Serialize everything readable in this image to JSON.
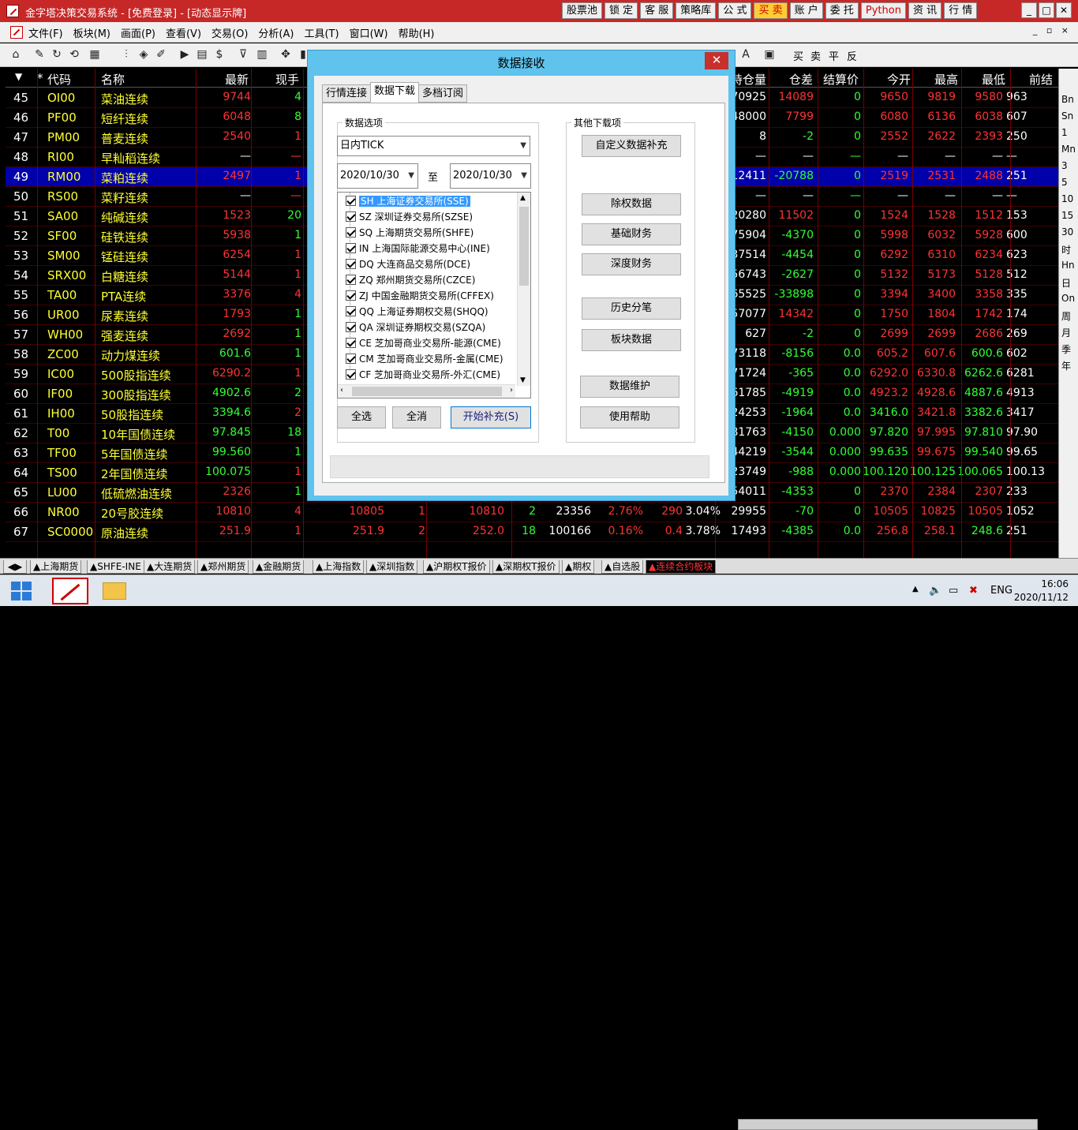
{
  "window": {
    "title": "金字塔决策交易系统 - [免费登录] - [动态显示牌]",
    "top_buttons": [
      "股票池",
      "锁 定",
      "客 服",
      "策略库",
      "公 式",
      "买 卖",
      "账 户",
      "委 托",
      "Python",
      "资 讯",
      "行 情"
    ],
    "controls": [
      "_",
      "□",
      "✕"
    ]
  },
  "menu": {
    "items": [
      "文件(F)",
      "板块(M)",
      "画面(P)",
      "查看(V)",
      "交易(O)",
      "分析(A)",
      "工具(T)",
      "窗口(W)",
      "帮助(H)"
    ],
    "right": "_ ▫ ×"
  },
  "toolbar": {
    "right_items": [
      "买",
      "卖",
      "平",
      "反"
    ]
  },
  "table": {
    "headers": [
      "▼",
      "*",
      "代码",
      "名称",
      "最新",
      "现手",
      "持仓量",
      "仓差",
      "结算价",
      "今开",
      "最高",
      "最低",
      "前结"
    ],
    "rows": [
      {
        "n": "45",
        "code": "OI00",
        "name": "菜油连续",
        "last": "9744",
        "vol": "4",
        "a": "",
        "b": "",
        "c": "",
        "d": "",
        "e": "",
        "f": "",
        "oi": "70925",
        "chg": "14089",
        "settle": "0",
        "open": "9650",
        "high": "9819",
        "low": "9580",
        "prev": "963"
      },
      {
        "n": "46",
        "code": "PF00",
        "name": "短纤连续",
        "last": "6048",
        "vol": "8",
        "a": "",
        "b": "",
        "c": "",
        "d": "",
        "e": "",
        "f": "",
        "oi": "48000",
        "chg": "7799",
        "settle": "0",
        "open": "6080",
        "high": "6136",
        "low": "6038",
        "prev": "607"
      },
      {
        "n": "47",
        "code": "PM00",
        "name": "普麦连续",
        "last": "2540",
        "vol": "1",
        "a": "",
        "b": "",
        "c": "",
        "d": "",
        "e": "",
        "f": "",
        "oi": "8",
        "chg": "-2",
        "settle": "0",
        "open": "2552",
        "high": "2622",
        "low": "2393",
        "prev": "250"
      },
      {
        "n": "48",
        "code": "RI00",
        "name": "早籼稻连续",
        "last": "—",
        "vol": "—",
        "a": "",
        "b": "",
        "c": "",
        "d": "",
        "e": "",
        "f": "",
        "oi": "—",
        "chg": "—",
        "settle": "—",
        "open": "—",
        "high": "—",
        "low": "—",
        "prev": "—"
      },
      {
        "n": "49",
        "code": "RM00",
        "name": "菜粕连续",
        "last": "2497",
        "vol": "1",
        "a": "",
        "b": "",
        "c": "",
        "d": "",
        "e": "",
        "f": "",
        "oi": "12411",
        "chg": "-20788",
        "settle": "0",
        "open": "2519",
        "high": "2531",
        "low": "2488",
        "prev": "251"
      },
      {
        "n": "50",
        "code": "RS00",
        "name": "菜籽连续",
        "last": "—",
        "vol": "—",
        "a": "",
        "b": "",
        "c": "",
        "d": "",
        "e": "",
        "f": "",
        "oi": "—",
        "chg": "—",
        "settle": "—",
        "open": "—",
        "high": "—",
        "low": "—",
        "prev": "—"
      },
      {
        "n": "51",
        "code": "SA00",
        "name": "纯碱连续",
        "last": "1523",
        "vol": "20",
        "a": "",
        "b": "",
        "c": "",
        "d": "",
        "e": "",
        "f": "",
        "oi": "20280",
        "chg": "11502",
        "settle": "0",
        "open": "1524",
        "high": "1528",
        "low": "1512",
        "prev": "153"
      },
      {
        "n": "52",
        "code": "SF00",
        "name": "硅铁连续",
        "last": "5938",
        "vol": "1",
        "a": "",
        "b": "",
        "c": "",
        "d": "",
        "e": "",
        "f": "",
        "oi": "75904",
        "chg": "-4370",
        "settle": "0",
        "open": "5998",
        "high": "6032",
        "low": "5928",
        "prev": "600"
      },
      {
        "n": "53",
        "code": "SM00",
        "name": "锰硅连续",
        "last": "6254",
        "vol": "1",
        "a": "",
        "b": "",
        "c": "",
        "d": "",
        "e": "",
        "f": "",
        "oi": "37514",
        "chg": "-4454",
        "settle": "0",
        "open": "6292",
        "high": "6310",
        "low": "6234",
        "prev": "623"
      },
      {
        "n": "54",
        "code": "SRX00",
        "name": "白糖连续",
        "last": "5144",
        "vol": "1",
        "a": "",
        "b": "",
        "c": "",
        "d": "",
        "e": "",
        "f": "",
        "oi": "56743",
        "chg": "-2627",
        "settle": "0",
        "open": "5132",
        "high": "5173",
        "low": "5128",
        "prev": "512"
      },
      {
        "n": "55",
        "code": "TA00",
        "name": "PTA连续",
        "last": "3376",
        "vol": "4",
        "a": "",
        "b": "",
        "c": "",
        "d": "",
        "e": "",
        "f": "",
        "oi": "65525",
        "chg": "-33898",
        "settle": "0",
        "open": "3394",
        "high": "3400",
        "low": "3358",
        "prev": "335"
      },
      {
        "n": "56",
        "code": "UR00",
        "name": "尿素连续",
        "last": "1793",
        "vol": "1",
        "a": "",
        "b": "",
        "c": "",
        "d": "",
        "e": "",
        "f": "",
        "oi": "57077",
        "chg": "14342",
        "settle": "0",
        "open": "1750",
        "high": "1804",
        "low": "1742",
        "prev": "174"
      },
      {
        "n": "57",
        "code": "WH00",
        "name": "强麦连续",
        "last": "2692",
        "vol": "1",
        "a": "",
        "b": "",
        "c": "",
        "d": "",
        "e": "",
        "f": "",
        "oi": "627",
        "chg": "-2",
        "settle": "0",
        "open": "2699",
        "high": "2699",
        "low": "2686",
        "prev": "269"
      },
      {
        "n": "58",
        "code": "ZC00",
        "name": "动力煤连续",
        "last": "601.6",
        "vol": "1",
        "a": "",
        "b": "",
        "c": "",
        "d": "",
        "e": "",
        "f": "",
        "oi": "73118",
        "chg": "-8156",
        "settle": "0.0",
        "open": "605.2",
        "high": "607.6",
        "low": "600.6",
        "prev": "602"
      },
      {
        "n": "59",
        "code": "IC00",
        "name": "500股指连续",
        "last": "6290.2",
        "vol": "1",
        "a": "",
        "b": "",
        "c": "",
        "d": "",
        "e": "",
        "f": "",
        "oi": "71724",
        "chg": "-365",
        "settle": "0.0",
        "open": "6292.0",
        "high": "6330.8",
        "low": "6262.6",
        "prev": "6281"
      },
      {
        "n": "60",
        "code": "IF00",
        "name": "300股指连续",
        "last": "4902.6",
        "vol": "2",
        "a": "",
        "b": "",
        "c": "",
        "d": "",
        "e": "",
        "f": "",
        "oi": "61785",
        "chg": "-4919",
        "settle": "0.0",
        "open": "4923.2",
        "high": "4928.6",
        "low": "4887.6",
        "prev": "4913"
      },
      {
        "n": "61",
        "code": "IH00",
        "name": "50股指连续",
        "last": "3394.6",
        "vol": "2",
        "a": "",
        "b": "",
        "c": "",
        "d": "",
        "e": "",
        "f": "",
        "oi": "24253",
        "chg": "-1964",
        "settle": "0.0",
        "open": "3416.0",
        "high": "3421.8",
        "low": "3382.6",
        "prev": "3417"
      },
      {
        "n": "62",
        "code": "T00",
        "name": "10年国债连续",
        "last": "97.845",
        "vol": "18",
        "a": "",
        "b": "",
        "c": "",
        "d": "",
        "e": "",
        "f": "",
        "oi": "81763",
        "chg": "-4150",
        "settle": "0.000",
        "open": "97.820",
        "high": "97.995",
        "low": "97.810",
        "prev": "97.90"
      },
      {
        "n": "63",
        "code": "TF00",
        "name": "5年国债连续",
        "last": "99.560",
        "vol": "1",
        "a": "",
        "b": "",
        "c": "",
        "d": "",
        "e": "",
        "f": "",
        "oi": "44219",
        "chg": "-3544",
        "settle": "0.000",
        "open": "99.635",
        "high": "99.675",
        "low": "99.540",
        "prev": "99.65"
      },
      {
        "n": "64",
        "code": "TS00",
        "name": "2年国债连续",
        "last": "100.075",
        "vol": "1",
        "a": "",
        "b": "",
        "c": "",
        "d": "",
        "e": "",
        "f": "",
        "oi": "23749",
        "chg": "-988",
        "settle": "0.000",
        "open": "100.120",
        "high": "100.125",
        "low": "100.065",
        "prev": "100.13"
      },
      {
        "n": "65",
        "code": "LU00",
        "name": "低硫燃油连续",
        "last": "2326",
        "vol": "1",
        "a": "",
        "b": "",
        "c": "",
        "d": "",
        "e": "",
        "f": "",
        "oi": "54011",
        "chg": "-4353",
        "settle": "0",
        "open": "2370",
        "high": "2384",
        "low": "2307",
        "prev": "233"
      },
      {
        "n": "66",
        "code": "NR00",
        "name": "20号胶连续",
        "last": "10810",
        "vol": "4",
        "a": "10805",
        "b": "1",
        "c": "10810",
        "d": "2",
        "e": "23356",
        "f": "2.76%",
        "g": "290",
        "h": "3.04%",
        "oi": "29955",
        "chg": "-70",
        "settle": "0",
        "open": "10505",
        "high": "10825",
        "low": "10505",
        "prev": "1052"
      },
      {
        "n": "67",
        "code": "SC0000",
        "name": "原油连续",
        "last": "251.9",
        "vol": "1",
        "a": "251.9",
        "b": "2",
        "c": "252.0",
        "d": "18",
        "e": "100166",
        "f": "0.16%",
        "g": "0.4",
        "h": "3.78%",
        "oi": "17493",
        "chg": "-4385",
        "settle": "0.0",
        "open": "256.8",
        "high": "258.1",
        "low": "248.6",
        "prev": "251"
      }
    ]
  },
  "right_panel": [
    "Bn",
    "Sn",
    "1",
    "Mn",
    "3",
    "5",
    "10",
    "15",
    "30",
    "时",
    "Hn",
    "日",
    "On",
    "周",
    "月",
    "季",
    "年"
  ],
  "bottom_tabs": [
    "▲上海期货",
    "▲SHFE-INE",
    "▲大连期货",
    "▲郑州期货",
    "▲金融期货",
    "▲上海指数",
    "▲深圳指数",
    "▲沪期权T报价",
    "▲深期权T报价",
    "▲期权",
    "▲自选股",
    "▲连续合约板块"
  ],
  "dialog": {
    "title": "数据接收",
    "close": "✕",
    "tabs": [
      "行情连接",
      "数据下载",
      "多档订阅"
    ],
    "data_options_label": "数据选项",
    "data_type": "日内TICK",
    "date_from": "2020/10/30",
    "to_label": "至",
    "date_to": "2020/10/30",
    "exchanges": [
      "SH 上海证券交易所(SSE)",
      "SZ 深圳证券交易所(SZSE)",
      "SQ 上海期货交易所(SHFE)",
      "IN 上海国际能源交易中心(INE)",
      "DQ 大连商品交易所(DCE)",
      "ZQ 郑州期货交易所(CZCE)",
      "ZJ 中国金融期货交易所(CFFEX)",
      "QQ 上海证券期权交易(SHQQ)",
      "QA 深圳证券期权交易(SZQA)",
      "CE 芝加哥商业交易所-能源(CME)",
      "CM 芝加哥商业交易所-金属(CME)",
      "CF 芝加哥商业交易所-外汇(CME)"
    ],
    "select_all": "全选",
    "deselect_all": "全消",
    "start": "开始补充(S)",
    "other_label": "其他下载项",
    "other_buttons": [
      "自定义数据补充",
      "除权数据",
      "基础财务",
      "深度财务",
      "历史分笔",
      "板块数据",
      "数据维护",
      "使用帮助"
    ]
  },
  "taskbar": {
    "lang": "ENG",
    "time": "16:06",
    "date": "2020/11/12"
  },
  "colors": {
    "red": "#ff3333",
    "green": "#33ff33",
    "yellow": "#ffff33",
    "white": "#ffffff",
    "selected": "#0000aa"
  }
}
